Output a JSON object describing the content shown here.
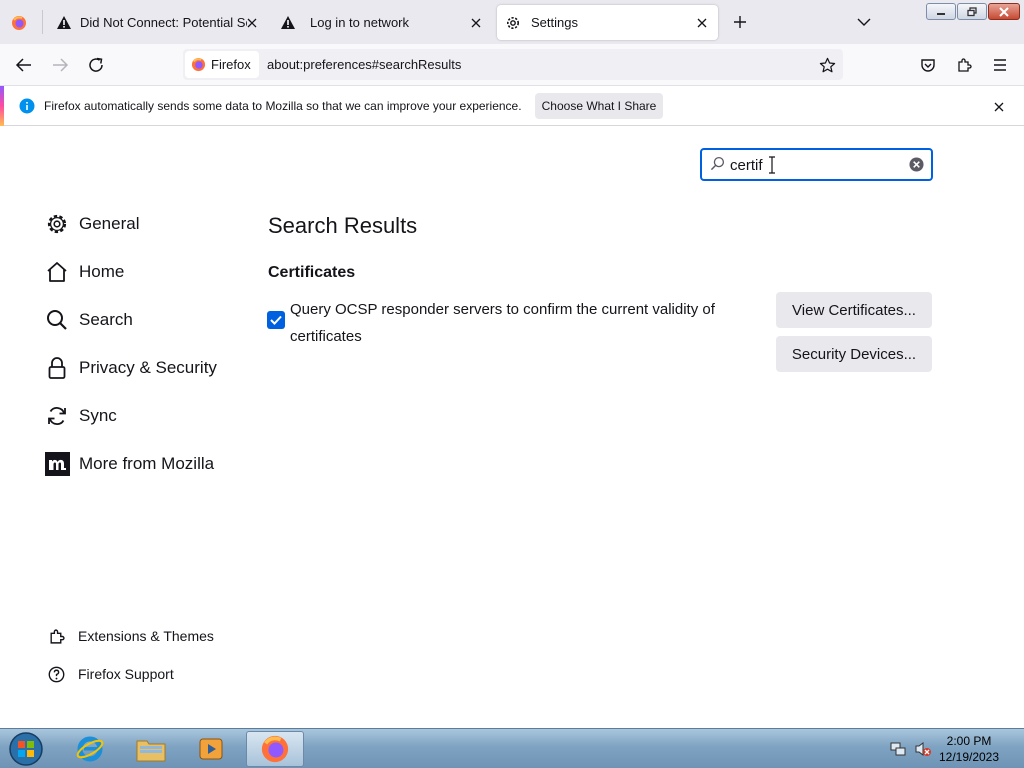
{
  "tabs": [
    {
      "title": "Did Not Connect: Potential Sec",
      "icon": "warning-icon",
      "active": false
    },
    {
      "title": "Log in to network",
      "icon": "warning-icon",
      "active": false
    },
    {
      "title": "Settings",
      "icon": "gear-icon",
      "active": true
    }
  ],
  "navbar": {
    "identity_label": "Firefox",
    "url": "about:preferences#searchResults"
  },
  "notification": {
    "message": "Firefox automatically sends some data to Mozilla so that we can improve your experience.",
    "button_label": "Choose What I Share"
  },
  "search": {
    "value": "certif"
  },
  "sidebar": {
    "categories": [
      {
        "label": "General",
        "icon": "gear-icon"
      },
      {
        "label": "Home",
        "icon": "home-icon"
      },
      {
        "label": "Search",
        "icon": "search-icon"
      },
      {
        "label": "Privacy & Security",
        "icon": "lock-icon"
      },
      {
        "label": "Sync",
        "icon": "sync-icon"
      },
      {
        "label": "More from Mozilla",
        "icon": "mozilla-icon"
      }
    ],
    "footer": [
      {
        "label": "Extensions & Themes",
        "icon": "puzzle-icon"
      },
      {
        "label": "Firefox Support",
        "icon": "help-icon"
      }
    ]
  },
  "main": {
    "title": "Search Results",
    "section_heading": "Certificates",
    "ocsp_label": "Query OCSP responder servers to confirm the current validity of certificates",
    "ocsp_checked": true,
    "view_certificates_label": "View Certificates...",
    "security_devices_label": "Security Devices..."
  },
  "taskbar": {
    "time": "2:00 PM",
    "date": "12/19/2023"
  },
  "colors": {
    "accent": "#0061e0",
    "tabstrip": "#e9e9ef",
    "button_bg": "#e9e9ed"
  }
}
